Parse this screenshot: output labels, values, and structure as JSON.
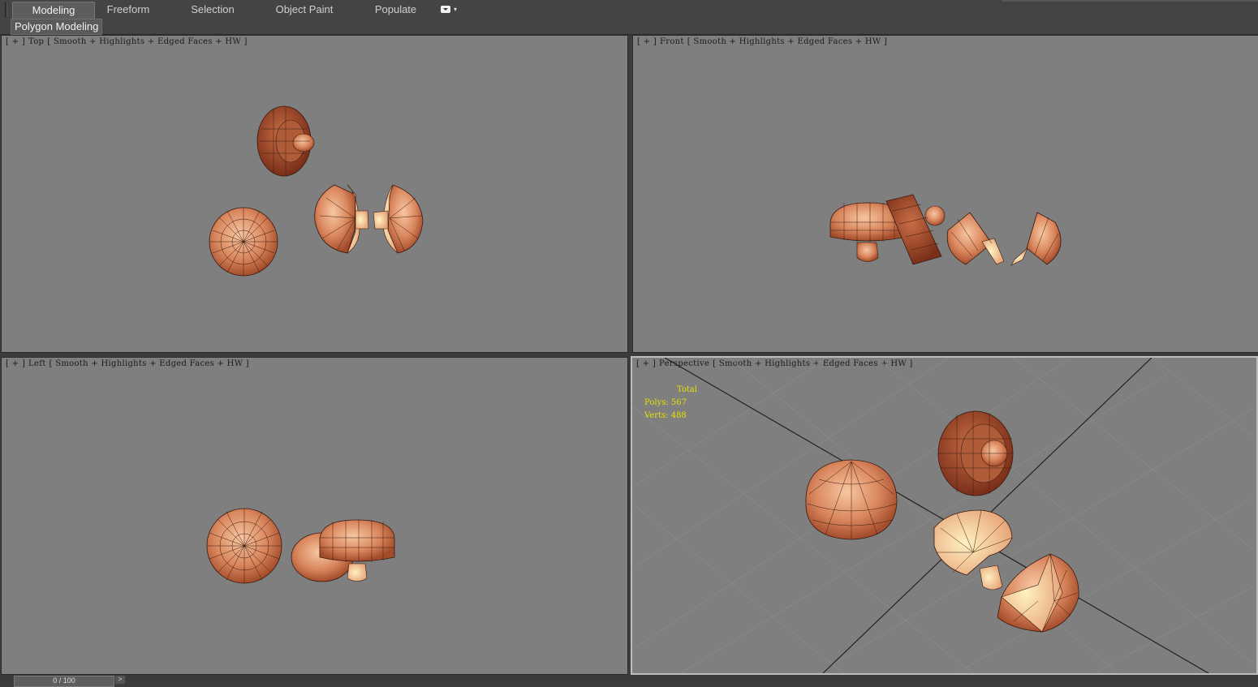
{
  "ribbon": {
    "tabs": [
      {
        "label": "Modeling",
        "active": true
      },
      {
        "label": "Freeform"
      },
      {
        "label": "Selection"
      },
      {
        "label": "Object Paint"
      },
      {
        "label": "Populate"
      }
    ],
    "options_icon": "ribbon-options-icon"
  },
  "subpanel": {
    "label": "Polygon Modeling"
  },
  "viewports": {
    "top": {
      "bracket_open": "[ + ]",
      "view": "Top",
      "shading": "[ Smooth + Highlights + Edged Faces + HW ]"
    },
    "front": {
      "bracket_open": "[ + ]",
      "view": "Front",
      "shading": "[ Smooth + Highlights + Edged Faces + HW ]"
    },
    "left": {
      "bracket_open": "[ + ]",
      "view": "Left",
      "shading": "[ Smooth + Highlights + Edged Faces + HW ]"
    },
    "perspective": {
      "bracket_open": "[ + ]",
      "view": "Perspective",
      "shading": "[ Smooth + Highlights + Edged Faces + HW ]",
      "stats": {
        "total_label": "Total",
        "polys": "Polys: 567",
        "verts": "Verts: 488"
      }
    }
  },
  "timeline": {
    "frame": "0 / 100",
    "next": ">"
  },
  "colors": {
    "viewport_bg": "#7f7f7f",
    "mushroom_cap": "#b8603a",
    "mushroom_light": "#f3c29a",
    "stats_text": "#e8e000"
  }
}
